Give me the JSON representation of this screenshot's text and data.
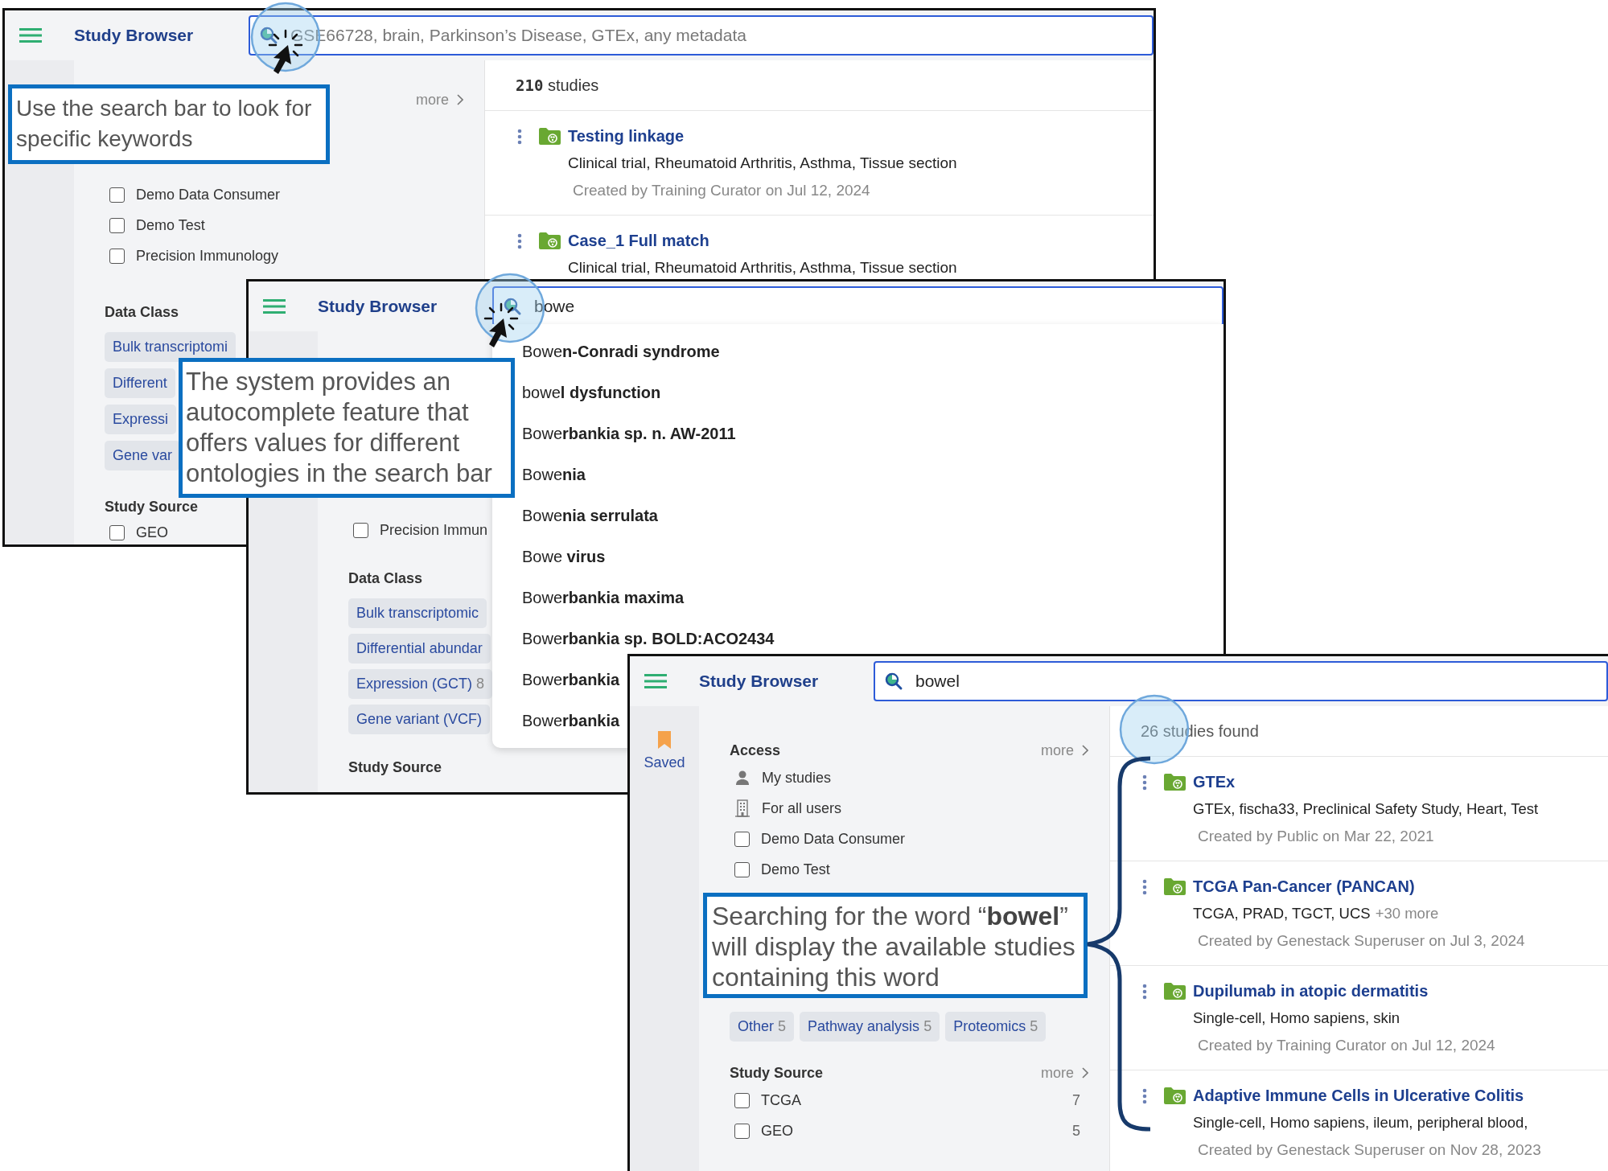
{
  "screens": [
    {
      "title": "Study Browser",
      "search": {
        "placeholder": "GSE66728, brain, Parkinson’s Disease, GTEx, any metadata"
      },
      "filters": [
        {
          "more": "more",
          "items": [
            {
              "kind": "checkbox",
              "label": "Demo Data Consumer",
              "checked": false
            },
            {
              "kind": "checkbox",
              "label": "Demo Test",
              "checked": false
            },
            {
              "kind": "checkbox",
              "label": "Precision Immunology",
              "checked": false
            }
          ]
        },
        {
          "heading": "Data Class",
          "chips": [
            {
              "label": "Bulk transcriptomi"
            },
            {
              "label": "Different"
            },
            {
              "label": "Expressi"
            },
            {
              "label": "Gene var"
            }
          ]
        },
        {
          "heading": "Study Source",
          "items": [
            {
              "kind": "checkbox",
              "label": "GEO",
              "checked": false
            }
          ]
        }
      ],
      "results": {
        "count": "210",
        "label": "studies",
        "studies": [
          {
            "title": "Testing linkage",
            "tags": "Clinical trial, Rheumatoid Arthritis, Asthma, Tissue section",
            "created": "Created by Training Curator on Jul 12, 2024"
          },
          {
            "title": "Case_1 Full match",
            "tags": "Clinical trial, Rheumatoid Arthritis, Asthma, Tissue section"
          }
        ]
      },
      "callout": "Use the search bar to look for specific keywords"
    },
    {
      "title": "Study Browser",
      "search": {
        "value": "bowe"
      },
      "filters": [
        {
          "items": [
            {
              "kind": "checkbox",
              "label": "Precision Immun",
              "checked": false
            }
          ]
        },
        {
          "heading": "Data Class",
          "chips": [
            {
              "label": "Bulk transcriptomic"
            },
            {
              "label": "Differential abundar"
            },
            {
              "label": "Expression (GCT)",
              "count": "8"
            },
            {
              "label": "Gene variant (VCF)"
            }
          ]
        },
        {
          "heading": "Study Source"
        }
      ],
      "suggestions": [
        "Bowe**n-Conradi syndrome**",
        "bowe**l dysfunction**",
        "Bowe**rbankia sp. n. AW-2011**",
        "Bowe**nia**",
        "Bowe**nia serrulata**",
        "Bowe **virus**",
        "Bowe**rbankia maxima**",
        "Bowe**rbankia sp. BOLD:ACO2434**",
        "Bowe**rbankia**",
        "Bowe**rbankia**"
      ],
      "callout": "The system provides an autocomplete feature that offers values for different ontologies in the search bar"
    },
    {
      "title": "Study Browser",
      "search": {
        "value": "bowel"
      },
      "saved": "Saved",
      "filters": [
        {
          "heading": "Access",
          "more": "more",
          "items": [
            {
              "kind": "person",
              "label": "My studies"
            },
            {
              "kind": "building",
              "label": "For all users"
            },
            {
              "kind": "checkbox",
              "label": "Demo Data Consumer",
              "checked": false
            },
            {
              "kind": "checkbox",
              "label": "Demo Test",
              "checked": false
            }
          ]
        },
        {
          "chips": [
            {
              "label": "Other",
              "count": "5"
            },
            {
              "label": "Pathway analysis",
              "count": "5"
            },
            {
              "label": "Proteomics",
              "count": "5"
            }
          ]
        },
        {
          "heading": "Study Source",
          "more": "more",
          "items": [
            {
              "kind": "checkbox",
              "label": "TCGA",
              "checked": false,
              "count": "7"
            },
            {
              "kind": "checkbox",
              "label": "GEO",
              "checked": false,
              "count": "5"
            }
          ]
        }
      ],
      "results": {
        "summary": "26 studies found",
        "studies": [
          {
            "title": "GTEx",
            "tags": "GTEx, fischa33, Preclinical Safety Study, Heart, Test",
            "created": "Created by Public on Mar 22, 2021"
          },
          {
            "title": "TCGA Pan-Cancer (PANCAN)",
            "tags": "TCGA, PRAD, TGCT, UCS",
            "more": "+30 more",
            "created": "Created by Genestack Superuser on Jul 3, 2024"
          },
          {
            "title": "Dupilumab in atopic dermatitis",
            "tags": "Single-cell, Homo sapiens, skin",
            "created": "Created by Training Curator on Jul 12, 2024"
          },
          {
            "title": "Adaptive Immune Cells in Ulcerative Colitis",
            "tags": "Single-cell, Homo sapiens, ileum, peripheral blood,",
            "created": "Created by Genestack Superuser on Nov 28, 2023"
          }
        ]
      },
      "callout": "Searching for the word “**bowel**” will display the available studies containing this word"
    }
  ]
}
